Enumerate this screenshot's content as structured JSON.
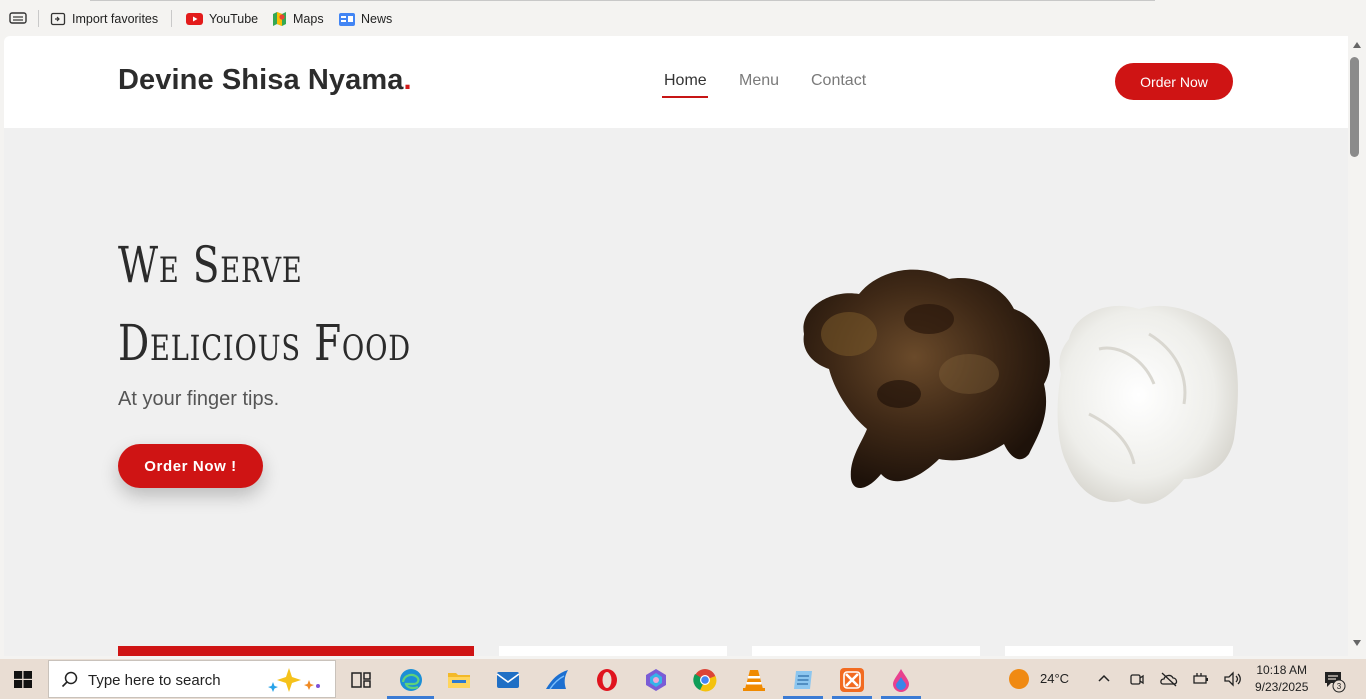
{
  "favorites_bar": {
    "items": [
      {
        "label": "Import favorites",
        "icon": "import-favorites-icon"
      },
      {
        "label": "YouTube",
        "icon": "youtube-icon"
      },
      {
        "label": "Maps",
        "icon": "maps-icon"
      },
      {
        "label": "News",
        "icon": "news-icon"
      }
    ]
  },
  "site": {
    "brand": "Devine Shisa Nyama",
    "brand_dot": ".",
    "nav": [
      {
        "label": "Home",
        "active": true
      },
      {
        "label": "Menu",
        "active": false
      },
      {
        "label": "Contact",
        "active": false
      }
    ],
    "order_button": "Order Now",
    "hero": {
      "title_line1": "We Serve",
      "title_line2": "Delicious Food",
      "subtitle": "At your finger tips.",
      "cta": "Order Now !"
    },
    "colors": {
      "accent": "#cf1414",
      "background": "#f0f0f0",
      "header": "#ffffff"
    }
  },
  "taskbar": {
    "search_placeholder": "Type here to search",
    "weather": "24°C",
    "time": "10:18 AM",
    "date": "9/23/2025",
    "notification_count": "3",
    "apps": [
      "task-view-icon",
      "edge-icon",
      "file-explorer-icon",
      "mail-icon",
      "app-shark-icon",
      "opera-icon",
      "copilot-icon",
      "chrome-icon",
      "vlc-icon",
      "notepad-icon",
      "xampp-icon",
      "paint-drop-icon"
    ]
  }
}
